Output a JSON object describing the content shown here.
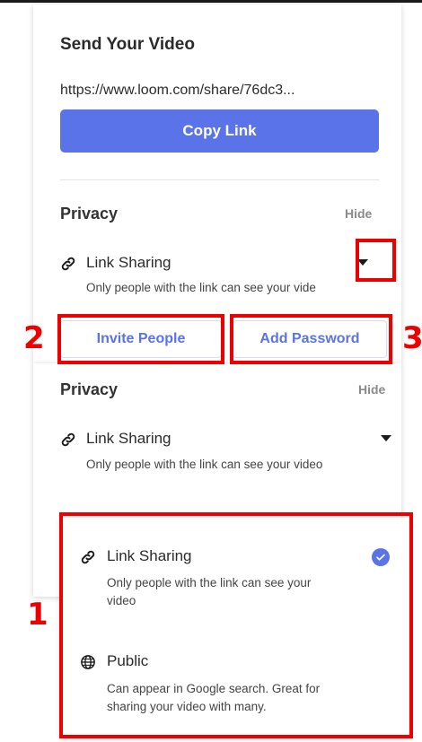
{
  "share": {
    "title": "Send Your Video",
    "url": "https://www.loom.com/share/76dc3...",
    "copy_label": "Copy Link"
  },
  "privacy": {
    "title": "Privacy",
    "hide_label": "Hide",
    "current_option": "Link Sharing",
    "current_desc_short": "Only people with the link can see your vide",
    "current_desc": "Only people with the link can see your video"
  },
  "actions": {
    "invite_label": "Invite People",
    "password_label": "Add Password"
  },
  "dropdown": {
    "options": [
      {
        "label": "Link Sharing",
        "desc_line1": "Only people with the link can see your",
        "desc_line2": "video",
        "selected": true
      },
      {
        "label": "Public",
        "desc_line1": "Can appear in Google search. Great for",
        "desc_line2": "sharing your video with many.",
        "selected": false
      }
    ]
  },
  "annotations": {
    "m1": "1",
    "m2": "2",
    "m3": "3"
  },
  "colors": {
    "accent": "#5b73e8",
    "annotation": "#ee0000"
  },
  "icons": {
    "link": "link-icon",
    "globe": "globe-icon",
    "caret": "caret-down-icon",
    "check": "check-icon"
  }
}
